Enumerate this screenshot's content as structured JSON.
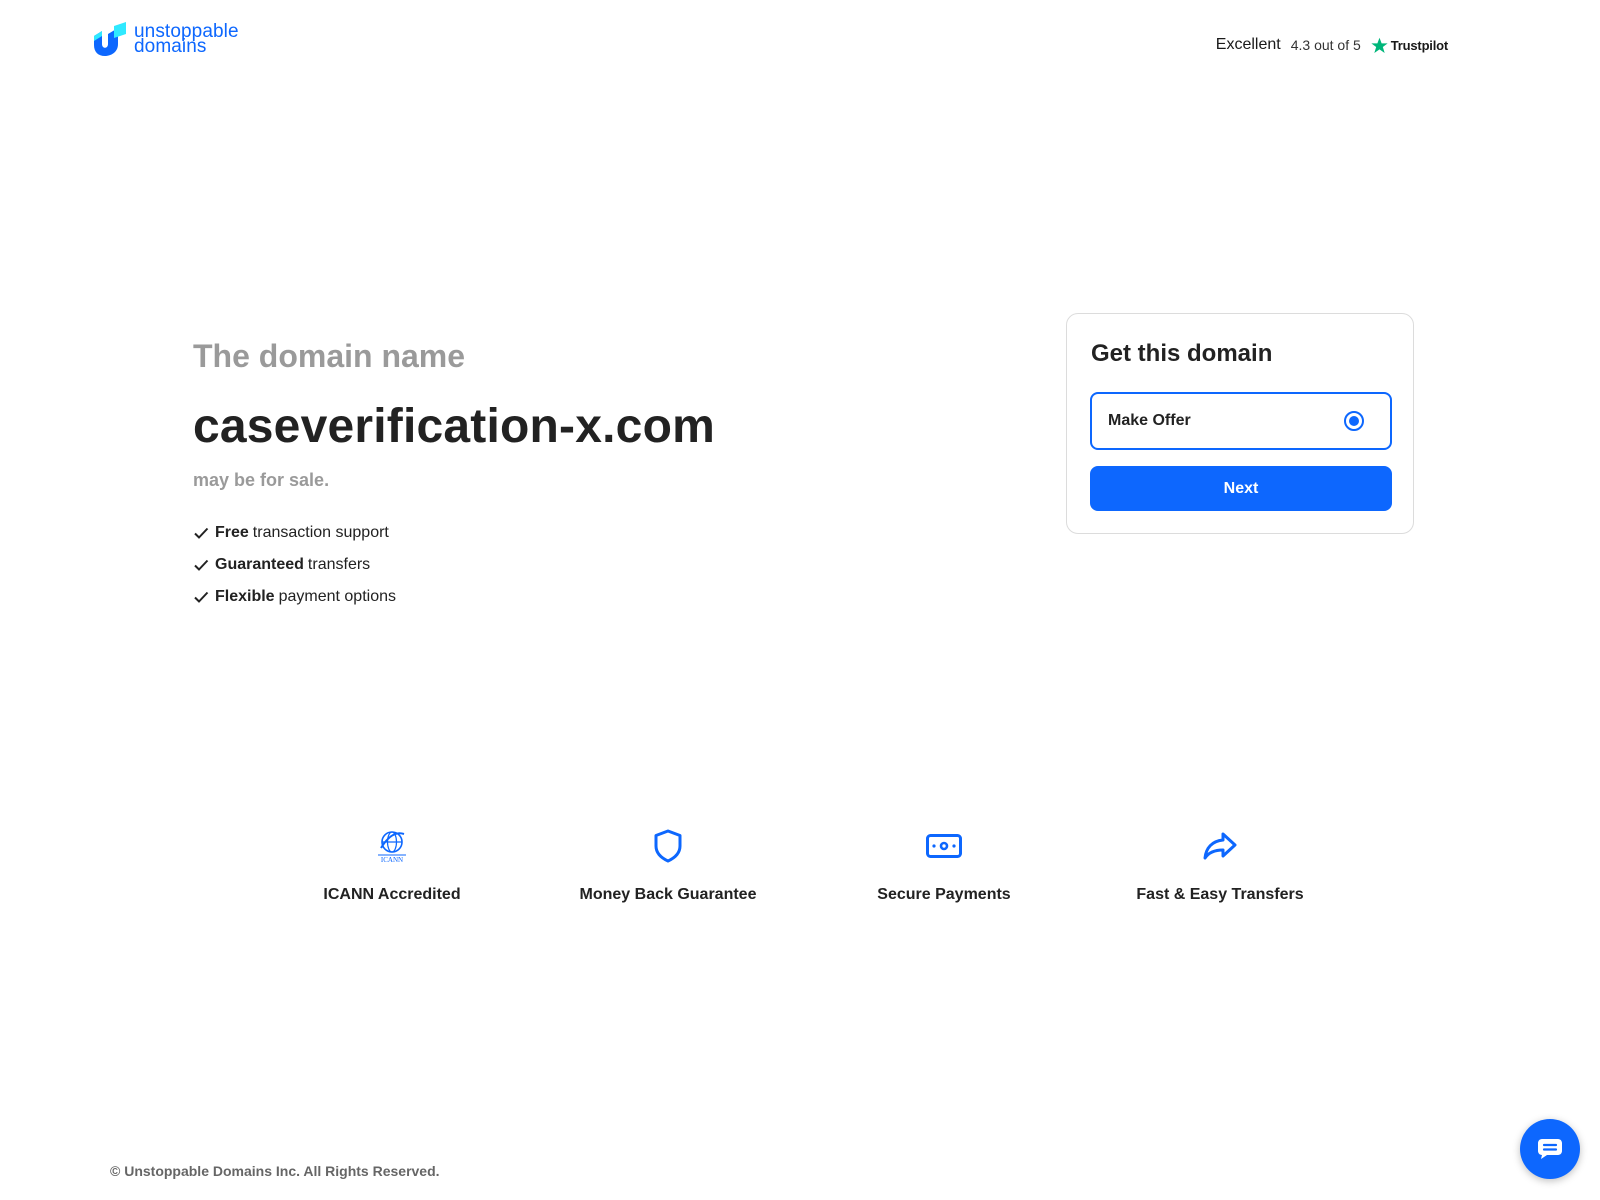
{
  "brand": {
    "line1": "unstoppable",
    "line2": "domains",
    "icon": "unstoppable-domains-logo-icon",
    "color": "#0d67fe"
  },
  "trustpilot": {
    "rating_word": "Excellent",
    "score": "4.3 out of 5",
    "brand": "Trustpilot",
    "star_color": "#00b67a",
    "icon": "star-icon"
  },
  "hero": {
    "intro": "The domain name",
    "domain": "caseverification-x.com",
    "subtitle": "may be for sale.",
    "features": [
      {
        "bold": "Free",
        "text": "transaction support"
      },
      {
        "bold": "Guaranteed",
        "text": "transfers"
      },
      {
        "bold": "Flexible",
        "text": "payment options"
      }
    ]
  },
  "card": {
    "title": "Get this domain",
    "option_label": "Make Offer",
    "option_selected": true,
    "next_label": "Next"
  },
  "badges": [
    {
      "label": "ICANN Accredited",
      "icon": "icann-icon"
    },
    {
      "label": "Money Back Guarantee",
      "icon": "shield-icon"
    },
    {
      "label": "Secure Payments",
      "icon": "payment-icon"
    },
    {
      "label": "Fast & Easy Transfers",
      "icon": "share-arrow-icon"
    }
  ],
  "footer": {
    "copyright": "© Unstoppable Domains Inc. All Rights Reserved."
  },
  "chat": {
    "icon": "chat-icon"
  }
}
